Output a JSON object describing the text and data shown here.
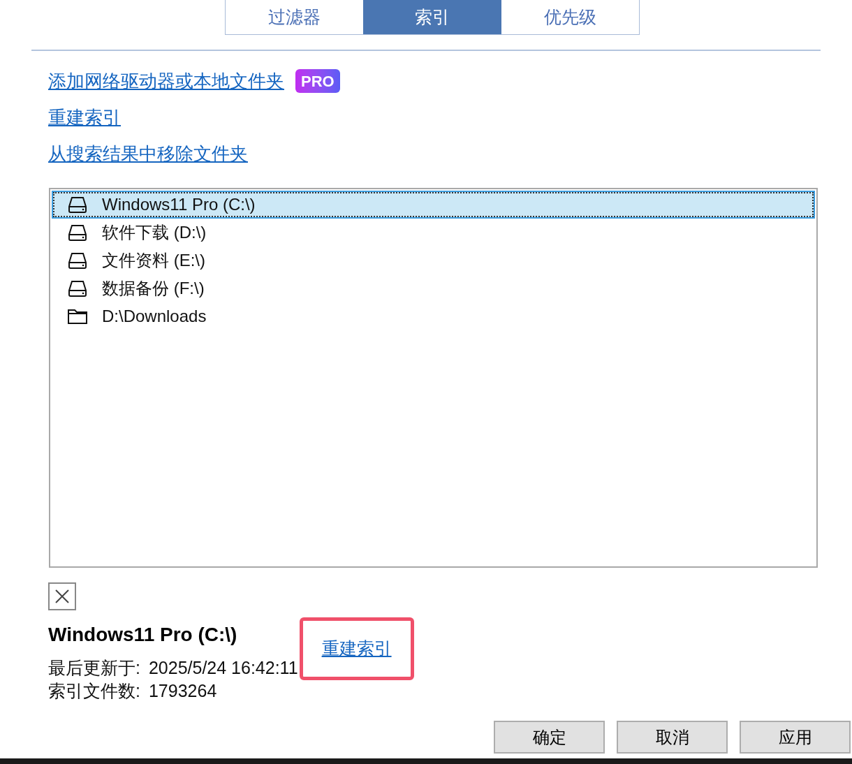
{
  "tabs": [
    {
      "label": "过滤器",
      "selected": false
    },
    {
      "label": "索引",
      "selected": true
    },
    {
      "label": "优先级",
      "selected": false
    }
  ],
  "links": [
    {
      "label": "添加网络驱动器或本地文件夹",
      "badge": "PRO"
    },
    {
      "label": "重建索引"
    },
    {
      "label": "从搜索结果中移除文件夹"
    }
  ],
  "locations": [
    {
      "kind": "drive",
      "label": "Windows11 Pro (C:\\)",
      "selected": true
    },
    {
      "kind": "drive",
      "label": "软件下载 (D:\\)",
      "selected": false
    },
    {
      "kind": "drive",
      "label": "文件资料 (E:\\)",
      "selected": false
    },
    {
      "kind": "drive",
      "label": "数据备份 (F:\\)",
      "selected": false
    },
    {
      "kind": "folder",
      "label": "D:\\Downloads",
      "selected": false
    }
  ],
  "details": {
    "title": "Windows11 Pro (C:\\)",
    "rows": [
      {
        "label": "最后更新于:",
        "value": "2025/5/24 16:42:11"
      },
      {
        "label": "索引文件数:",
        "value": "1793264"
      }
    ],
    "rebuild_link": {
      "label": "重建索引",
      "highlighted": true
    }
  },
  "buttons": [
    "确定",
    "取消",
    "应用"
  ]
}
